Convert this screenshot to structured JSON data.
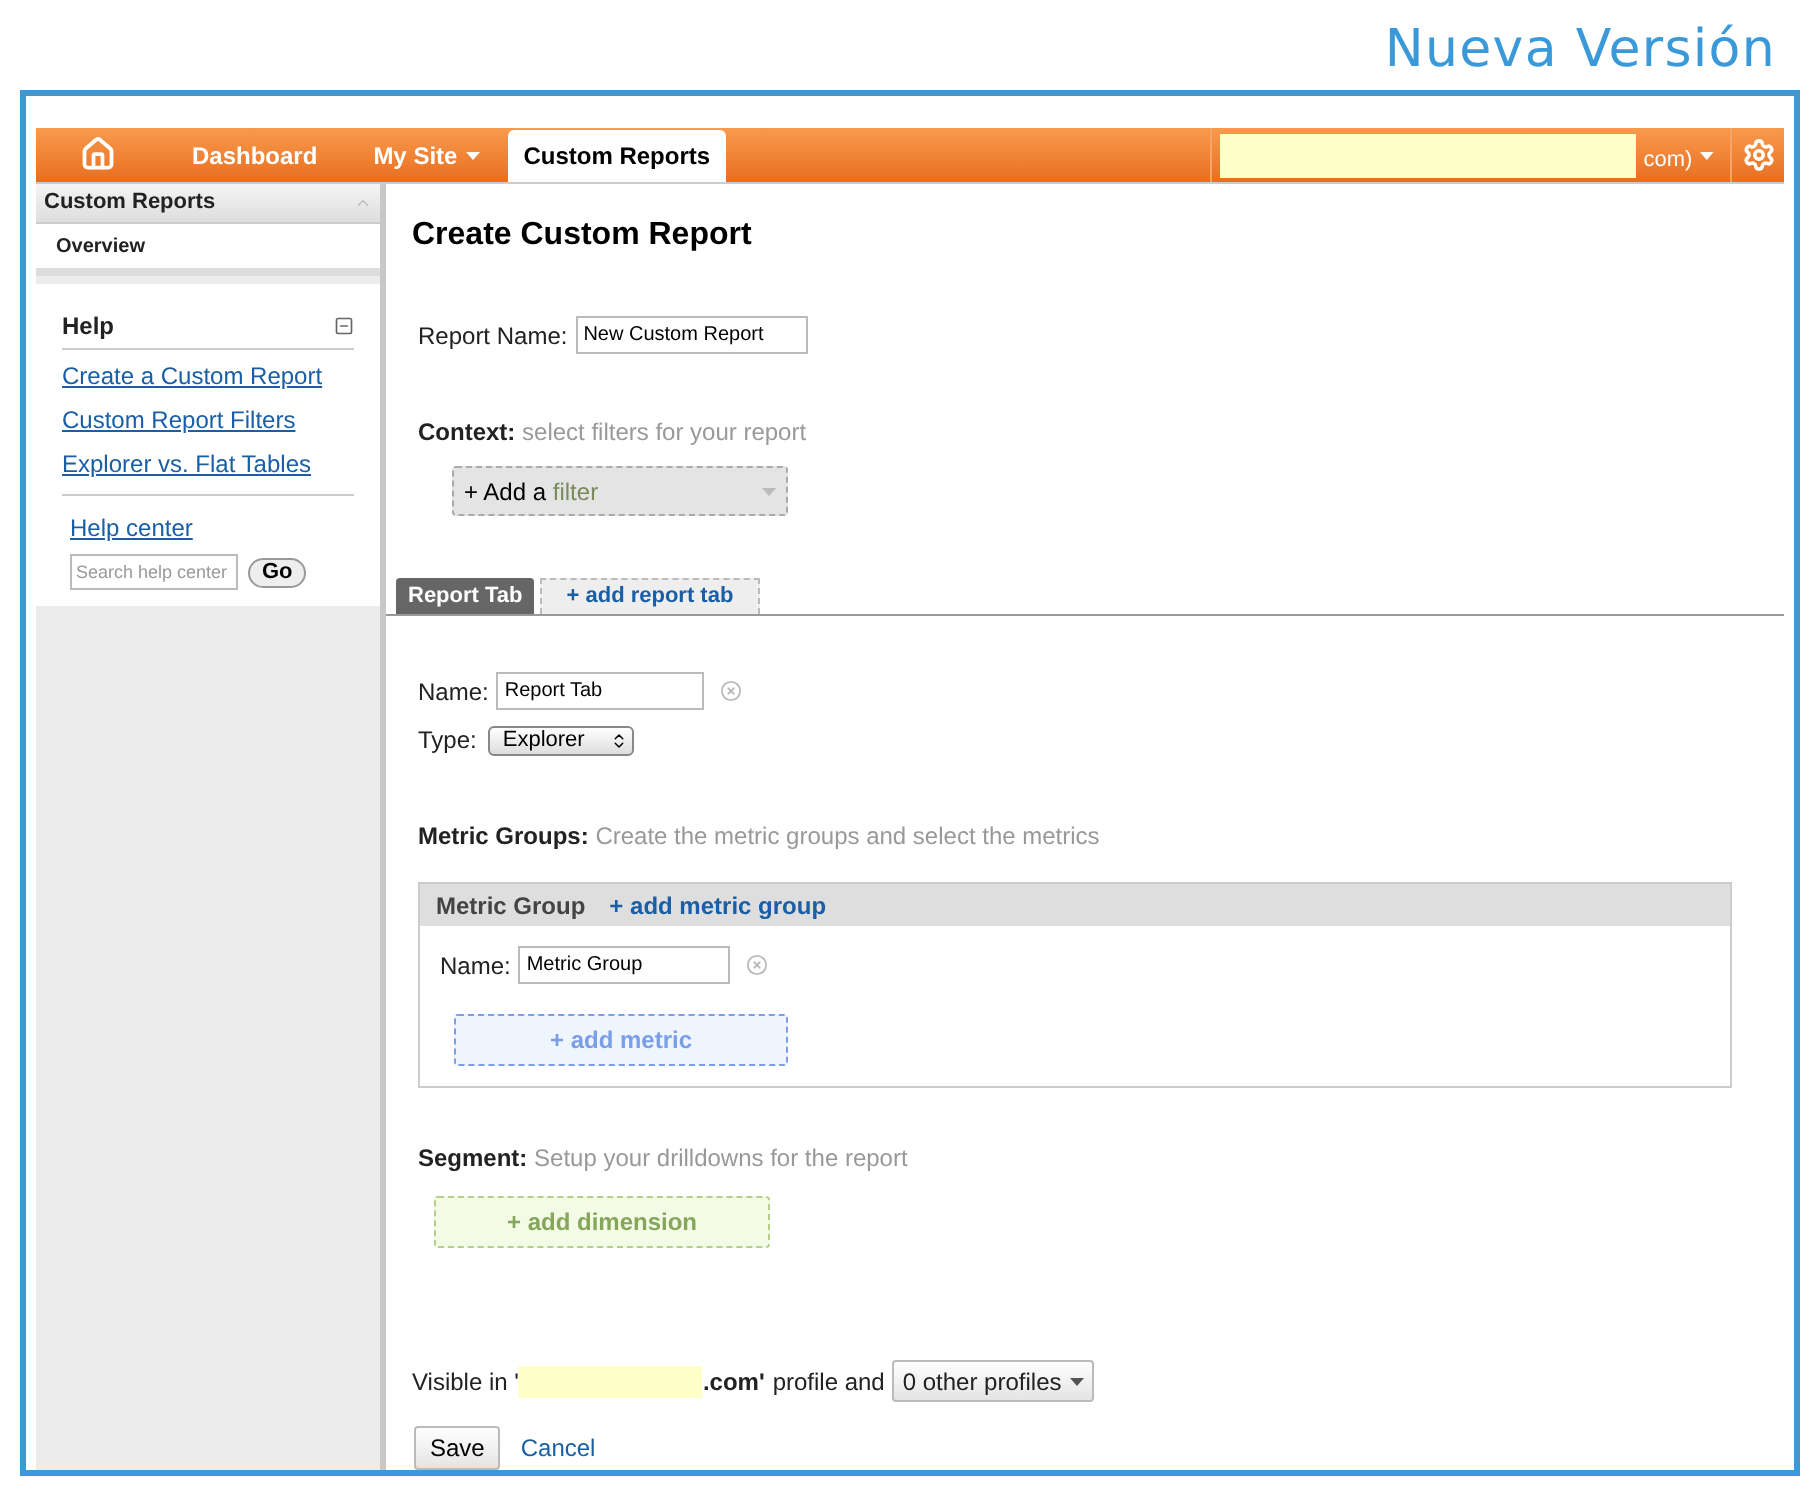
{
  "banner_title": "Nueva Versión",
  "nav": {
    "items": [
      {
        "label": "Dashboard",
        "selected": false,
        "dropdown": false
      },
      {
        "label": "My Site",
        "selected": false,
        "dropdown": true
      },
      {
        "label": "Custom Reports",
        "selected": true,
        "dropdown": false
      }
    ],
    "account_suffix": "com)"
  },
  "sidebar": {
    "section_title": "Custom Reports",
    "items": [
      {
        "label": "Overview",
        "selected": true
      }
    ],
    "help": {
      "title": "Help",
      "links": [
        "Create a Custom Report",
        "Custom Report Filters",
        "Explorer vs. Flat Tables"
      ],
      "help_center": "Help center",
      "search_placeholder": "Search help center",
      "go_button": "Go"
    }
  },
  "main": {
    "title": "Create Custom Report",
    "report_name": {
      "label": "Report Name:",
      "value": "New Custom Report"
    },
    "context": {
      "label": "Context:",
      "hint": "select filters for your report",
      "filter_button": "+ Add a",
      "filter_word": "filter"
    },
    "tabs": [
      {
        "label": "Report Tab",
        "selected": true
      },
      {
        "label": "+ add report tab",
        "selected": false
      }
    ],
    "tab_name": {
      "label": "Name:",
      "value": "Report Tab"
    },
    "tab_type": {
      "label": "Type:",
      "value": "Explorer"
    },
    "metric_groups": {
      "label": "Metric Groups:",
      "hint": "Create the metric groups and select the metrics",
      "tabs": [
        {
          "label": "Metric Group",
          "selected": true
        },
        {
          "label": "+ add metric group",
          "selected": false
        }
      ],
      "name": {
        "label": "Name:",
        "value": "Metric Group"
      },
      "add_metric": "+ add metric"
    },
    "segment": {
      "label": "Segment:",
      "hint": "Setup your drilldowns for the report",
      "add_dimension": "+ add dimension"
    },
    "visibility": {
      "prefix": "Visible in '",
      "domain_suffix": ".com'",
      "suffix": "profile and",
      "profiles_dropdown": "0 other profiles"
    },
    "save_button": "Save",
    "cancel_link": "Cancel"
  }
}
